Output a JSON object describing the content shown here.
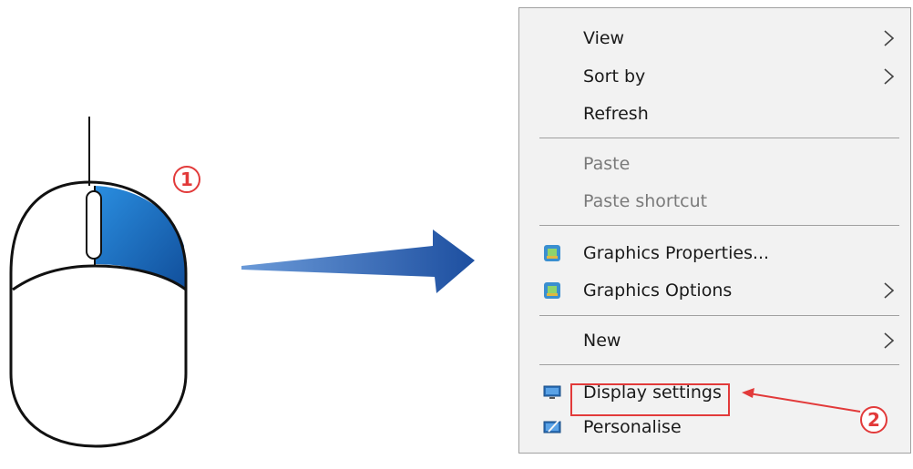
{
  "callouts": {
    "step1": "1",
    "step2": "2"
  },
  "menu": {
    "items": [
      {
        "label": "View",
        "submenu": true
      },
      {
        "label": "Sort by",
        "submenu": true
      },
      {
        "label": "Refresh"
      },
      {
        "label": "Paste",
        "disabled": true
      },
      {
        "label": "Paste shortcut",
        "disabled": true
      },
      {
        "label": "Graphics Properties...",
        "icon": "graphics-icon"
      },
      {
        "label": "Graphics Options",
        "icon": "graphics-icon",
        "submenu": true
      },
      {
        "label": "New",
        "submenu": true
      },
      {
        "label": "Display settings",
        "icon": "monitor-icon"
      },
      {
        "label": "Personalise",
        "icon": "personalise-icon"
      }
    ]
  },
  "colors": {
    "accent": "#1f6dbf",
    "annotation": "#e23a3a",
    "menu_bg": "#f2f2f2"
  }
}
